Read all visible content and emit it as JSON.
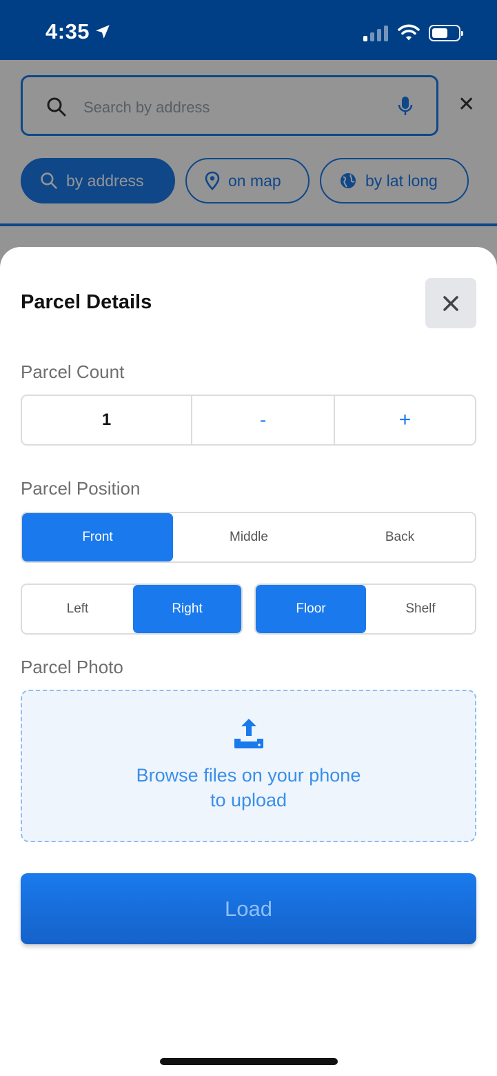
{
  "status_bar": {
    "time": "4:35"
  },
  "search": {
    "placeholder": "Search by address",
    "modes": [
      {
        "label": "by address",
        "icon": "search-icon",
        "active": true
      },
      {
        "label": "on map",
        "icon": "pin-icon",
        "active": false
      },
      {
        "label": "by lat long",
        "icon": "globe-icon",
        "active": false
      }
    ]
  },
  "sheet": {
    "title": "Parcel Details",
    "parcel_count": {
      "label": "Parcel Count",
      "value": "1",
      "decrement": "-",
      "increment": "+"
    },
    "parcel_position": {
      "label": "Parcel Position",
      "depth_options": [
        "Front",
        "Middle",
        "Back"
      ],
      "depth_selected": "Front",
      "side_options": [
        "Left",
        "Right"
      ],
      "side_selected": "Right",
      "level_options": [
        "Floor",
        "Shelf"
      ],
      "level_selected": "Floor"
    },
    "parcel_photo": {
      "label": "Parcel Photo",
      "upload_line1": "Browse files on your phone",
      "upload_line2": "to upload"
    },
    "load_label": "Load"
  },
  "colors": {
    "primary": "#1a7aed",
    "header": "#003f86"
  }
}
